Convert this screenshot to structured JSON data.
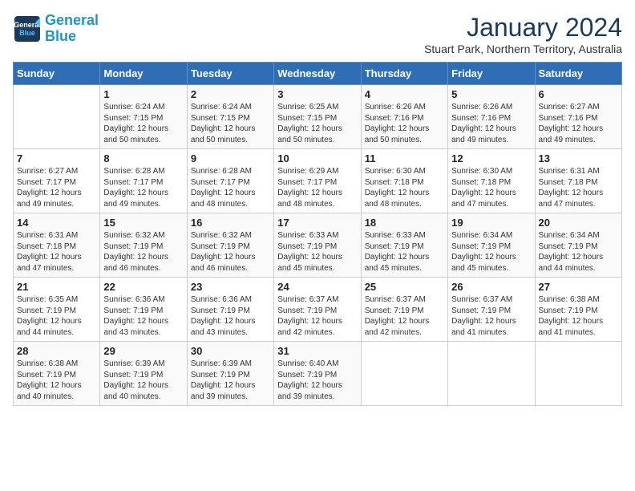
{
  "header": {
    "logo_line1": "General",
    "logo_line2": "Blue",
    "month": "January 2024",
    "location": "Stuart Park, Northern Territory, Australia"
  },
  "days_of_week": [
    "Sunday",
    "Monday",
    "Tuesday",
    "Wednesday",
    "Thursday",
    "Friday",
    "Saturday"
  ],
  "weeks": [
    [
      {
        "day": "",
        "info": ""
      },
      {
        "day": "1",
        "info": "Sunrise: 6:24 AM\nSunset: 7:15 PM\nDaylight: 12 hours\nand 50 minutes."
      },
      {
        "day": "2",
        "info": "Sunrise: 6:24 AM\nSunset: 7:15 PM\nDaylight: 12 hours\nand 50 minutes."
      },
      {
        "day": "3",
        "info": "Sunrise: 6:25 AM\nSunset: 7:15 PM\nDaylight: 12 hours\nand 50 minutes."
      },
      {
        "day": "4",
        "info": "Sunrise: 6:26 AM\nSunset: 7:16 PM\nDaylight: 12 hours\nand 50 minutes."
      },
      {
        "day": "5",
        "info": "Sunrise: 6:26 AM\nSunset: 7:16 PM\nDaylight: 12 hours\nand 49 minutes."
      },
      {
        "day": "6",
        "info": "Sunrise: 6:27 AM\nSunset: 7:16 PM\nDaylight: 12 hours\nand 49 minutes."
      }
    ],
    [
      {
        "day": "7",
        "info": "Sunrise: 6:27 AM\nSunset: 7:17 PM\nDaylight: 12 hours\nand 49 minutes."
      },
      {
        "day": "8",
        "info": "Sunrise: 6:28 AM\nSunset: 7:17 PM\nDaylight: 12 hours\nand 49 minutes."
      },
      {
        "day": "9",
        "info": "Sunrise: 6:28 AM\nSunset: 7:17 PM\nDaylight: 12 hours\nand 48 minutes."
      },
      {
        "day": "10",
        "info": "Sunrise: 6:29 AM\nSunset: 7:17 PM\nDaylight: 12 hours\nand 48 minutes."
      },
      {
        "day": "11",
        "info": "Sunrise: 6:30 AM\nSunset: 7:18 PM\nDaylight: 12 hours\nand 48 minutes."
      },
      {
        "day": "12",
        "info": "Sunrise: 6:30 AM\nSunset: 7:18 PM\nDaylight: 12 hours\nand 47 minutes."
      },
      {
        "day": "13",
        "info": "Sunrise: 6:31 AM\nSunset: 7:18 PM\nDaylight: 12 hours\nand 47 minutes."
      }
    ],
    [
      {
        "day": "14",
        "info": "Sunrise: 6:31 AM\nSunset: 7:18 PM\nDaylight: 12 hours\nand 47 minutes."
      },
      {
        "day": "15",
        "info": "Sunrise: 6:32 AM\nSunset: 7:19 PM\nDaylight: 12 hours\nand 46 minutes."
      },
      {
        "day": "16",
        "info": "Sunrise: 6:32 AM\nSunset: 7:19 PM\nDaylight: 12 hours\nand 46 minutes."
      },
      {
        "day": "17",
        "info": "Sunrise: 6:33 AM\nSunset: 7:19 PM\nDaylight: 12 hours\nand 45 minutes."
      },
      {
        "day": "18",
        "info": "Sunrise: 6:33 AM\nSunset: 7:19 PM\nDaylight: 12 hours\nand 45 minutes."
      },
      {
        "day": "19",
        "info": "Sunrise: 6:34 AM\nSunset: 7:19 PM\nDaylight: 12 hours\nand 45 minutes."
      },
      {
        "day": "20",
        "info": "Sunrise: 6:34 AM\nSunset: 7:19 PM\nDaylight: 12 hours\nand 44 minutes."
      }
    ],
    [
      {
        "day": "21",
        "info": "Sunrise: 6:35 AM\nSunset: 7:19 PM\nDaylight: 12 hours\nand 44 minutes."
      },
      {
        "day": "22",
        "info": "Sunrise: 6:36 AM\nSunset: 7:19 PM\nDaylight: 12 hours\nand 43 minutes."
      },
      {
        "day": "23",
        "info": "Sunrise: 6:36 AM\nSunset: 7:19 PM\nDaylight: 12 hours\nand 43 minutes."
      },
      {
        "day": "24",
        "info": "Sunrise: 6:37 AM\nSunset: 7:19 PM\nDaylight: 12 hours\nand 42 minutes."
      },
      {
        "day": "25",
        "info": "Sunrise: 6:37 AM\nSunset: 7:19 PM\nDaylight: 12 hours\nand 42 minutes."
      },
      {
        "day": "26",
        "info": "Sunrise: 6:37 AM\nSunset: 7:19 PM\nDaylight: 12 hours\nand 41 minutes."
      },
      {
        "day": "27",
        "info": "Sunrise: 6:38 AM\nSunset: 7:19 PM\nDaylight: 12 hours\nand 41 minutes."
      }
    ],
    [
      {
        "day": "28",
        "info": "Sunrise: 6:38 AM\nSunset: 7:19 PM\nDaylight: 12 hours\nand 40 minutes."
      },
      {
        "day": "29",
        "info": "Sunrise: 6:39 AM\nSunset: 7:19 PM\nDaylight: 12 hours\nand 40 minutes."
      },
      {
        "day": "30",
        "info": "Sunrise: 6:39 AM\nSunset: 7:19 PM\nDaylight: 12 hours\nand 39 minutes."
      },
      {
        "day": "31",
        "info": "Sunrise: 6:40 AM\nSunset: 7:19 PM\nDaylight: 12 hours\nand 39 minutes."
      },
      {
        "day": "",
        "info": ""
      },
      {
        "day": "",
        "info": ""
      },
      {
        "day": "",
        "info": ""
      }
    ]
  ]
}
